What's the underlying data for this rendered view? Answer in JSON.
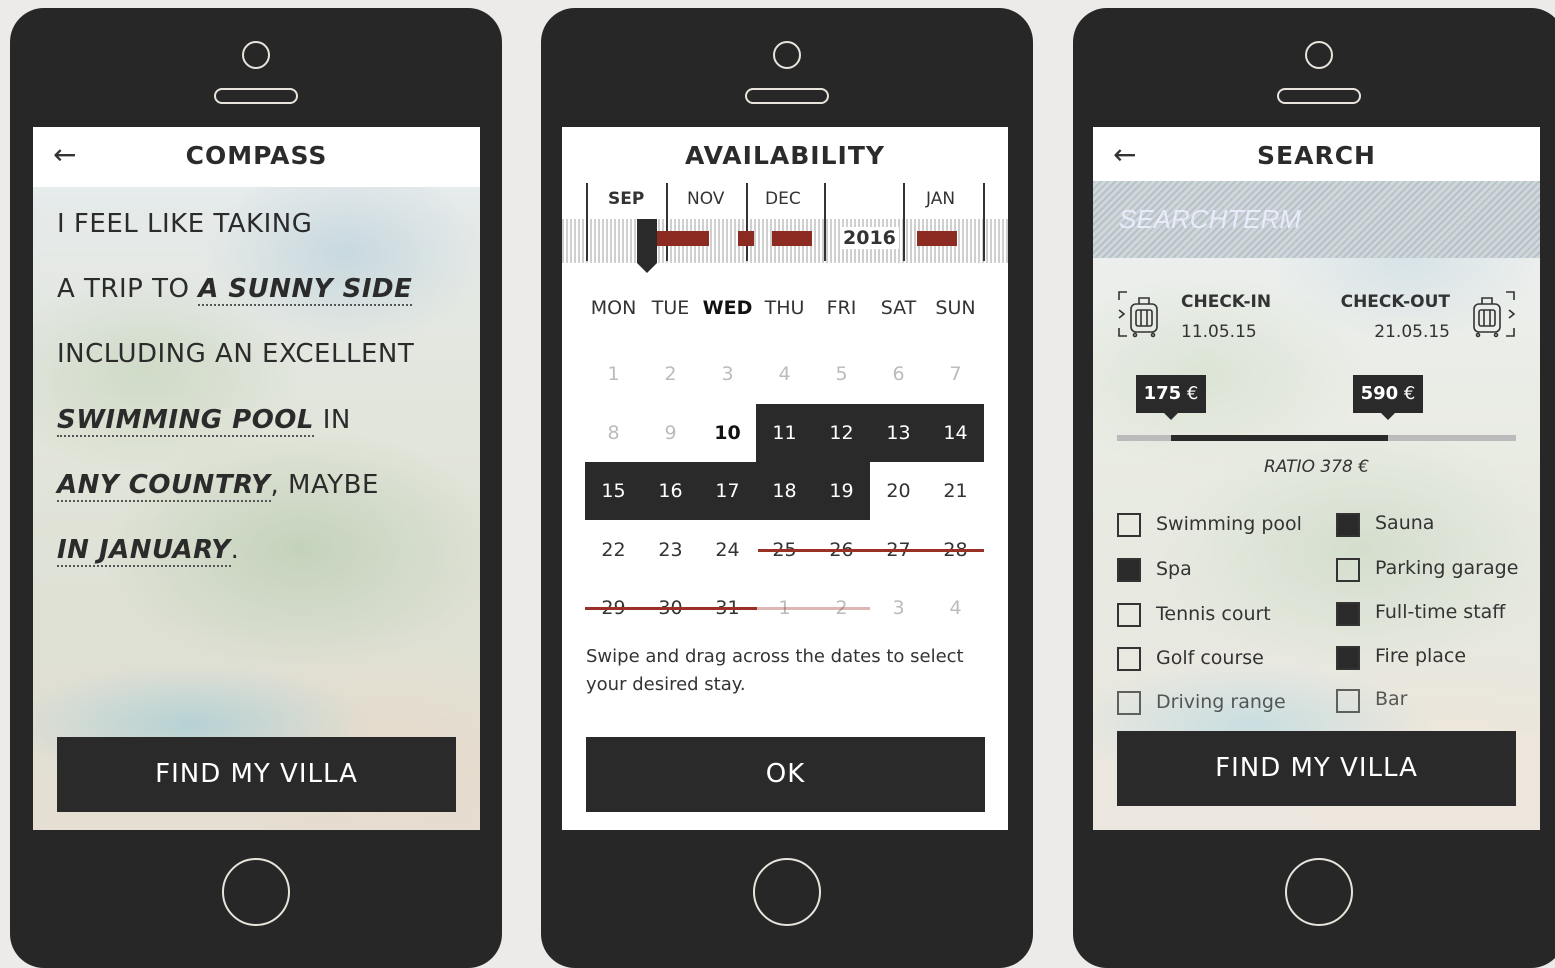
{
  "compass": {
    "title": "COMPASS",
    "back": "←",
    "lines": {
      "l1": "I FEEL LIKE TAKING",
      "l2a": "A TRIP TO ",
      "l2b": "A SUNNY SIDE",
      "l3": "INCLUDING AN EXCELLENT",
      "l4a": "SWIMMING POOL",
      "l4b": " IN",
      "l5a": "ANY COUNTRY",
      "l5b": ", MAYBE",
      "l6a": "IN JANUARY",
      "l6b": "."
    },
    "button": "FIND MY VILLA"
  },
  "availability": {
    "title": "AVAILABILITY",
    "months": [
      "SEP",
      "NOV",
      "DEC",
      "2016",
      "JAN"
    ],
    "weekdays": [
      "MON",
      "TUE",
      "WED",
      "THU",
      "FRI",
      "SAT",
      "SUN"
    ],
    "days": [
      [
        "1",
        "2",
        "3",
        "4",
        "5",
        "6",
        "7"
      ],
      [
        "8",
        "9",
        "10",
        "11",
        "12",
        "13",
        "14"
      ],
      [
        "15",
        "16",
        "17",
        "18",
        "19",
        "20",
        "21"
      ],
      [
        "22",
        "23",
        "24",
        "25",
        "26",
        "27",
        "28"
      ],
      [
        "29",
        "30",
        "31",
        "1",
        "2",
        "3",
        "4"
      ]
    ],
    "hint": "Swipe and drag across the dates to select your desired stay.",
    "button": "OK"
  },
  "search": {
    "title": "SEARCH",
    "back": "←",
    "searchterm_placeholder": "SEARCHTERM",
    "checkin_label": "CHECK-IN",
    "checkin_date": "11.05.15",
    "checkout_label": "CHECK-OUT",
    "checkout_date": "21.05.15",
    "price_min": "175",
    "price_max": "590",
    "currency": "€",
    "ratio": "RATIO 378 €",
    "amenities": [
      {
        "label": "Swimming pool",
        "checked": false
      },
      {
        "label": "Sauna",
        "checked": true
      },
      {
        "label": "Spa",
        "checked": true
      },
      {
        "label": "Parking garage",
        "checked": false
      },
      {
        "label": "Tennis court",
        "checked": false
      },
      {
        "label": "Full-time staff",
        "checked": true
      },
      {
        "label": "Golf course",
        "checked": false
      },
      {
        "label": "Fire place",
        "checked": true
      },
      {
        "label": "Driving range",
        "checked": false
      },
      {
        "label": "Bar",
        "checked": false
      }
    ],
    "button": "FIND MY VILLA"
  },
  "colors": {
    "dark": "#2a2a2a",
    "accent_red": "#8b2b22",
    "background": "#ecebea"
  }
}
